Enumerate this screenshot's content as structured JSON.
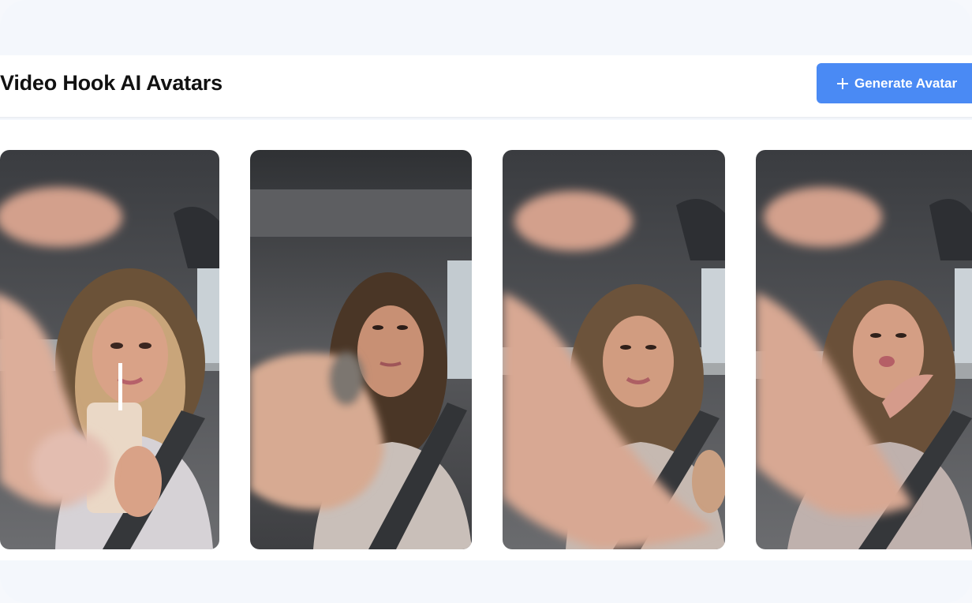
{
  "header": {
    "title": "Video Hook AI Avatars",
    "generate_button_label": "Generate Avatar",
    "generate_button_icon": "plus-icon",
    "accent_color": "#4a8af4"
  },
  "avatars": [
    {
      "pose": "holding drink with straw",
      "hand": "finger-pointing"
    },
    {
      "pose": "fist pointing at camera",
      "hand": "fist"
    },
    {
      "pose": "smiling",
      "hand": "finger-pointing"
    },
    {
      "pose": "blowing a kiss",
      "hand": "finger-pointing"
    }
  ]
}
